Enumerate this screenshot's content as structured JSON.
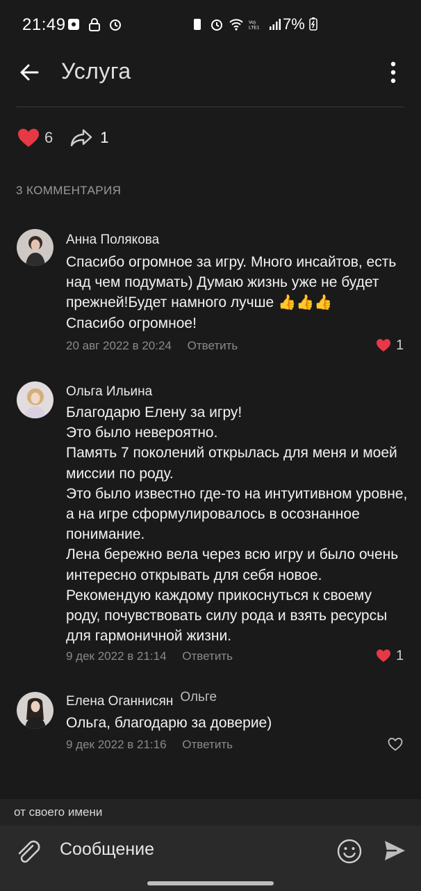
{
  "status_bar": {
    "time": "21:49",
    "battery": "7%"
  },
  "app_bar": {
    "title": "Услуга",
    "back_icon": "arrow-left-icon",
    "menu_icon": "more-vertical-icon"
  },
  "reactions": {
    "likes": "6",
    "shares": "1",
    "like_color": "#e53945"
  },
  "comments_header": "3 КОММЕНТАРИЯ",
  "comments": [
    {
      "author": "Анна Полякова",
      "reply_to": "",
      "text": "Спасибо огромное за игру. Много инсайтов, есть над чем подумать) Думаю жизнь уже не будет прежней!Будет намного лучше 👍👍👍\nСпасибо огромное!",
      "date": "20 авг 2022 в 20:24",
      "reply_label": "Ответить",
      "likes": "1",
      "liked": true
    },
    {
      "author": "Ольга Ильина",
      "reply_to": "",
      "text": "Благодарю Елену за игру!\nЭто было невероятно.\nПамять 7 поколений открылась для меня и моей миссии по роду.\nЭто было известно где-то на интуитивном уровне, а на игре сформулировалось в осознанное понимание.\nЛена бережно вела через всю игру и было очень интересно открывать для себя новое.\nРекомендую каждому прикоснуться к своему роду, почувствовать силу рода и взять ресурсы для гармоничной жизни.",
      "date": "9 дек 2022 в 21:14",
      "reply_label": "Ответить",
      "likes": "1",
      "liked": true
    },
    {
      "author": "Елена Оганнисян",
      "reply_to": "Ольге",
      "text": "Ольга, благодарю за доверие)",
      "date": "9 дек 2022 в 21:16",
      "reply_label": "Ответить",
      "likes": "",
      "liked": false
    }
  ],
  "composer": {
    "from_label": "от своего имени",
    "placeholder": "Сообщение",
    "attach_icon": "paperclip-icon",
    "emoji_icon": "smile-icon",
    "send_icon": "send-icon"
  }
}
